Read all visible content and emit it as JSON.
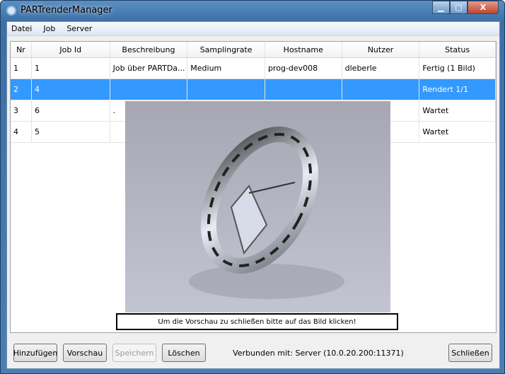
{
  "window": {
    "title": "PARTrenderManager",
    "minimize": "▁",
    "maximize": "□",
    "close": "X"
  },
  "menu": [
    "Datei",
    "Job",
    "Server"
  ],
  "table": {
    "columns": [
      "Nr",
      "Job Id",
      "Beschreibung",
      "Samplingrate",
      "Hostname",
      "Nutzer",
      "Status"
    ],
    "rows": [
      [
        "1",
        "1",
        "Job über PARTDa...",
        "Medium",
        "prog-dev008",
        "dleberle",
        "Fertig (1 Bild)"
      ],
      [
        "2",
        "4",
        "",
        "",
        "",
        "",
        "Rendert 1/1"
      ],
      [
        "3",
        "6",
        ".",
        "",
        "",
        "",
        "Wartet"
      ],
      [
        "4",
        "5",
        "",
        "",
        "",
        "",
        "Wartet"
      ]
    ],
    "selected_row": 1
  },
  "preview": {
    "caption": "Um die Vorschau zu schließen bitte auf das Bild klicken!"
  },
  "buttons": {
    "add": "Hinzufügen",
    "preview": "Vorschau",
    "save": "Speichern",
    "delete": "Löschen",
    "close": "Schließen"
  },
  "status": "Verbunden mit: Server (10.0.20.200:11371)"
}
